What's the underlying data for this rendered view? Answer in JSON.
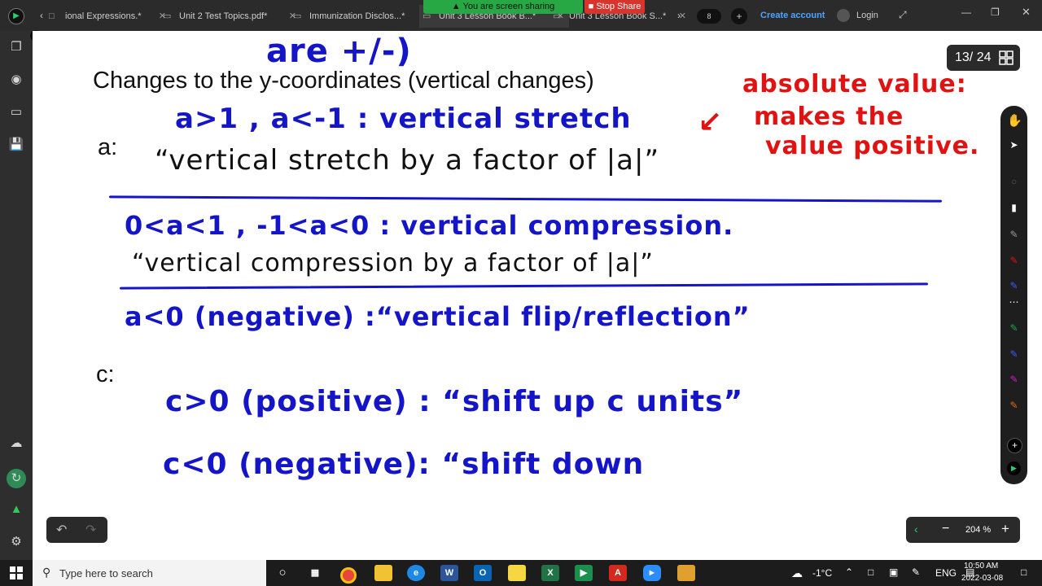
{
  "tabs": [
    {
      "label": "ional Expressions.*",
      "icon": "document-icon"
    },
    {
      "label": "Unit 2 Test Topics.pdf*",
      "icon": "document-icon"
    },
    {
      "label": "Immunization Disclos...*",
      "icon": "document-icon"
    },
    {
      "label": "Unit 3 Lesson Book B...*",
      "icon": "document-icon"
    },
    {
      "label": "Unit 3 Lesson Book S...*",
      "icon": "document-icon"
    }
  ],
  "share": {
    "sharing_text": "You are screen sharing",
    "stop_label": "Stop Share"
  },
  "header": {
    "tab_count": "8",
    "create_account": "Create account",
    "login": "Login"
  },
  "pager": {
    "counter": "13/ 24"
  },
  "notes": {
    "top_fragment": "are +/-)",
    "heading": "Changes to the y-coordinates (vertical changes)",
    "a_label": "a:",
    "a_stretch": "a>1 , a<-1 : vertical stretch",
    "a_stretch_quote": "“vertical stretch by a factor of |a|”",
    "red_note_1": "absolute value:",
    "red_note_2": "makes the",
    "red_note_3": "value positive.",
    "a_compress": "0<a<1 , -1<a<0 : vertical compression.",
    "a_compress_quote": "“vertical compression by a factor of |a|”",
    "a_flip": "a<0 (negative) :“vertical flip/reflection”",
    "c_label": "c:",
    "c_up": "c>0 (positive) : “shift up c units”",
    "c_down": "c<0 (negative): “shift down"
  },
  "zoom": {
    "level": "204 %"
  },
  "taskbar": {
    "search_placeholder": "Type here to search",
    "weather": "-1°C",
    "language": "ENG",
    "time": "10:50 AM",
    "date": "2022-03-08"
  },
  "colors": {
    "ink_blue": "#1515c8",
    "ink_red": "#e01212",
    "share_green": "#28a745",
    "stop_red": "#d9342b"
  }
}
